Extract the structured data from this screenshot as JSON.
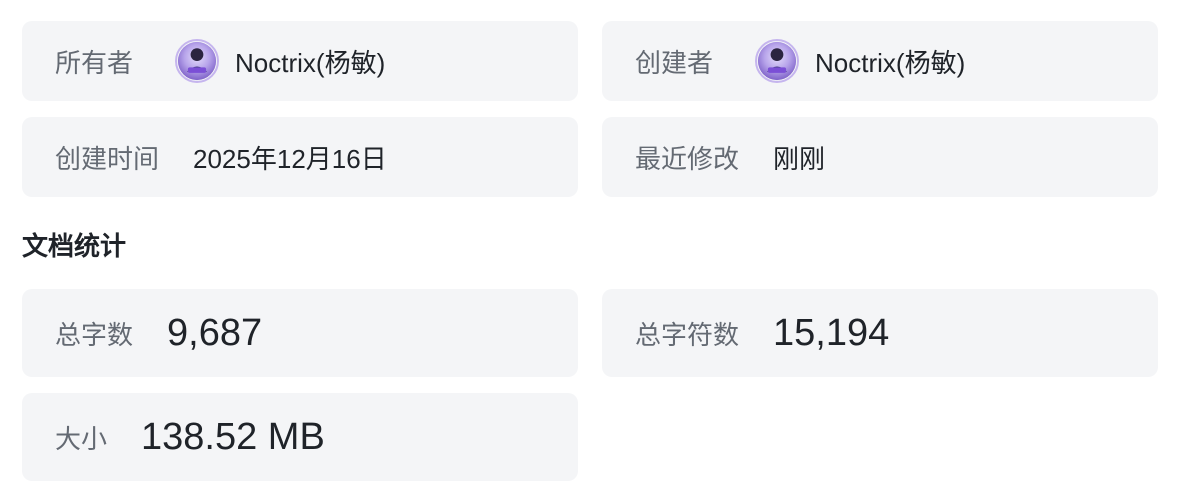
{
  "owner": {
    "label": "所有者",
    "name": "Noctrix(杨敏)"
  },
  "creator": {
    "label": "创建者",
    "name": "Noctrix(杨敏)"
  },
  "created": {
    "label": "创建时间",
    "value": "2025年12月16日"
  },
  "modified": {
    "label": "最近修改",
    "value": "刚刚"
  },
  "stats": {
    "title": "文档统计",
    "word_count": {
      "label": "总字数",
      "value": "9,687"
    },
    "char_count": {
      "label": "总字符数",
      "value": "15,194"
    },
    "size": {
      "label": "大小",
      "value": "138.52 MB"
    }
  }
}
